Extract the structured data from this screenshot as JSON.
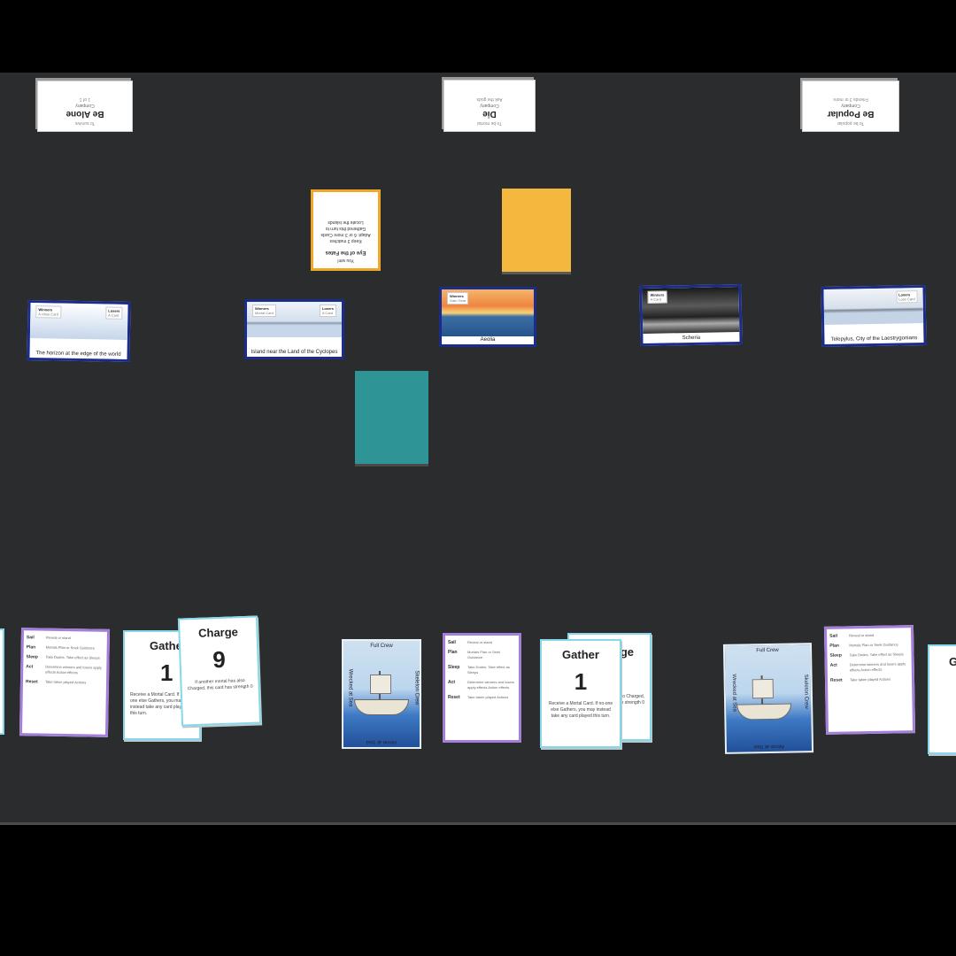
{
  "goals": [
    {
      "top": "To survive",
      "title": "Be Alone",
      "sub1": "Company",
      "sub2": "1 of 1"
    },
    {
      "top": "To be mortal",
      "title": "Die",
      "sub1": "Company",
      "sub2": "Ask the gods"
    },
    {
      "top": "To be popular",
      "title": "Be Popular",
      "sub1": "Company",
      "sub2": "Friends 3 or more"
    }
  ],
  "event_card": {
    "line1": "You win!",
    "title": "Eye of the Fates",
    "line2": "Keep 3 matches",
    "line3": "Adapt: 6 or 3 more Cards",
    "line4": "Gathered this turn to",
    "line5": "Locate the islands"
  },
  "locations": [
    {
      "tag_left": "Winners",
      "tag_left_sub": "A close Card",
      "tag_right": "Losers",
      "tag_right_sub": "A Card",
      "caption": "The horizon at the edge of the world"
    },
    {
      "tag_left": "Winners",
      "tag_left_sub": "Mortal Card",
      "tag_right": "Losers",
      "tag_right_sub": "A Card",
      "caption": "Island near the Land of the Cyclopes"
    },
    {
      "tag_left": "Winners",
      "tag_left_sub": "Gain Gear",
      "tag_right": "",
      "tag_right_sub": "",
      "caption": "Aeolia"
    },
    {
      "tag_left": "Winners",
      "tag_left_sub": "A Card",
      "tag_right": "",
      "tag_right_sub": "",
      "caption": "Scheria"
    },
    {
      "tag_left": "",
      "tag_left_sub": "",
      "tag_right": "Losers",
      "tag_right_sub": "Lose Card",
      "caption": "Telepylus, City of the Laestrygonians"
    }
  ],
  "crew": {
    "sail_label": "Sail",
    "sail_text": "Reveal or stand",
    "plan_label": "Plan",
    "plan_text": "Mortals Plan or Seek Guidance",
    "sleep_label": "Sleep",
    "sleep_text": "Take Dudes. Take effect as Sleeps",
    "act_label": "Act",
    "act_text": "Determine winners and losers apply effects Action effects",
    "reset_label": "Reset",
    "reset_text": "Take taken played Actions"
  },
  "actions": {
    "gather_title": "Gather",
    "gather_num": "1",
    "gather_desc": "Receive a Mortal Card. If no-one else Gathers, you may instead take any card played this turn.",
    "charge_title": "Charge",
    "charge_num": "9",
    "charge_desc": "If another mortal has also Charged, this card has strength 0"
  },
  "ship_card": {
    "top": "Full Crew",
    "bottom": "Alone at Sea",
    "left": "Wrecked at Sea",
    "right": "Skeleton Crew"
  },
  "colors": {
    "table": "#2b2c2e",
    "location_border": "#1a2c8c",
    "crew_border": "#a37fd8",
    "action_border": "#87d7ea",
    "deck_orange": "#f4b83e",
    "deck_teal": "#2f9496"
  }
}
